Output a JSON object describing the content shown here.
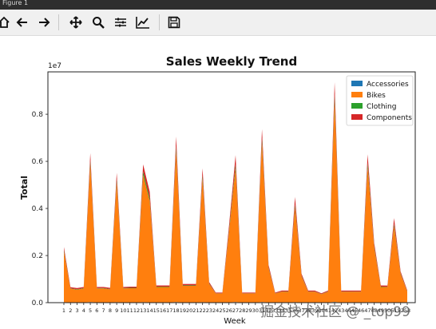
{
  "window": {
    "title": "Figure 1"
  },
  "toolbar": {
    "buttons": [
      {
        "name": "home-icon"
      },
      {
        "name": "back-icon"
      },
      {
        "name": "forward-icon"
      },
      {
        "name": "pan-icon"
      },
      {
        "name": "zoom-icon"
      },
      {
        "name": "configure-subplots-icon"
      },
      {
        "name": "edit-axis-icon"
      },
      {
        "name": "save-icon"
      }
    ]
  },
  "watermark": "掘金技术社区 @ _top99",
  "chart_data": {
    "type": "area",
    "stacked": true,
    "title": "Sales Weekly Trend",
    "xlabel": "Week",
    "ylabel": "Total",
    "y_offset_label": "1e7",
    "ylim": [
      0,
      9800000
    ],
    "yticks": [
      0,
      2000000,
      4000000,
      6000000,
      8000000
    ],
    "ytick_labels": [
      "0.0",
      "0.2",
      "0.4",
      "0.6",
      "0.8"
    ],
    "x": [
      "1",
      "2",
      "3",
      "4",
      "5",
      "6",
      "7",
      "8",
      "9",
      "10",
      "11",
      "12",
      "13",
      "14",
      "15",
      "16",
      "17",
      "18",
      "19",
      "20",
      "21",
      "22",
      "23",
      "24",
      "25",
      "26",
      "27",
      "28",
      "29",
      "30",
      "31",
      "32",
      "33",
      "34",
      "35",
      "36",
      "37",
      "38",
      "39",
      "40",
      "41",
      "42",
      "43",
      "44",
      "45",
      "46",
      "47",
      "48",
      "49",
      "50",
      "51",
      "52",
      "53"
    ],
    "legend": {
      "position": "upper right"
    },
    "series": [
      {
        "name": "Accessories",
        "color": "#1f77b4",
        "values": [
          20000,
          12000,
          12000,
          12000,
          25000,
          12000,
          12000,
          12000,
          22000,
          12000,
          12000,
          12000,
          22000,
          18000,
          12000,
          12000,
          12000,
          25000,
          12000,
          12000,
          12000,
          22000,
          12000,
          10000,
          10000,
          12000,
          25000,
          10000,
          10000,
          10000,
          25000,
          12000,
          10000,
          10000,
          12000,
          20000,
          10000,
          10000,
          10000,
          10000,
          12000,
          28000,
          10000,
          10000,
          10000,
          10000,
          20000,
          12000,
          12000,
          10000,
          10000,
          10000,
          20000
        ]
      },
      {
        "name": "Bikes",
        "color": "#ff7f0e",
        "values": [
          2150000,
          580000,
          540000,
          590000,
          5900000,
          590000,
          590000,
          550000,
          5100000,
          590000,
          600000,
          600000,
          5400000,
          4300000,
          650000,
          650000,
          650000,
          6450000,
          700000,
          700000,
          700000,
          5250000,
          780000,
          380000,
          380000,
          2950000,
          5700000,
          380000,
          380000,
          380000,
          6800000,
          1450000,
          380000,
          450000,
          450000,
          4050000,
          1100000,
          450000,
          450000,
          350000,
          450000,
          8600000,
          450000,
          450000,
          450000,
          450000,
          5750000,
          2300000,
          650000,
          650000,
          3250000,
          1200000,
          450000
        ]
      },
      {
        "name": "Clothing",
        "color": "#2ca02c",
        "values": [
          60000,
          15000,
          15000,
          15000,
          140000,
          15000,
          15000,
          15000,
          130000,
          15000,
          15000,
          15000,
          150000,
          110000,
          15000,
          15000,
          15000,
          180000,
          20000,
          20000,
          20000,
          140000,
          20000,
          10000,
          10000,
          80000,
          160000,
          10000,
          10000,
          10000,
          180000,
          40000,
          10000,
          12000,
          12000,
          110000,
          30000,
          12000,
          12000,
          10000,
          12000,
          250000,
          12000,
          12000,
          12000,
          12000,
          170000,
          60000,
          15000,
          15000,
          90000,
          30000,
          12000
        ]
      },
      {
        "name": "Components",
        "color": "#d62728",
        "values": [
          130000,
          50000,
          50000,
          50000,
          280000,
          50000,
          50000,
          50000,
          260000,
          50000,
          50000,
          50000,
          300000,
          280000,
          50000,
          50000,
          50000,
          400000,
          60000,
          60000,
          60000,
          290000,
          60000,
          30000,
          30000,
          200000,
          380000,
          30000,
          30000,
          30000,
          360000,
          100000,
          30000,
          40000,
          40000,
          310000,
          80000,
          40000,
          40000,
          30000,
          40000,
          480000,
          40000,
          40000,
          40000,
          40000,
          360000,
          150000,
          50000,
          50000,
          240000,
          80000,
          40000
        ]
      }
    ]
  }
}
